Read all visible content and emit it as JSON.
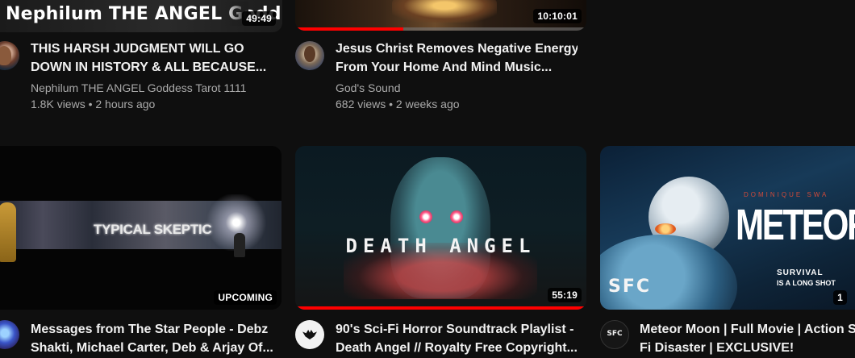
{
  "videos": [
    {
      "thumb_text": "Nephilum THE ANGEL Godd",
      "duration": "49:49",
      "title_line1": "THIS HARSH JUDGMENT WILL GO",
      "title_line2": "DOWN IN HISTORY & ALL BECAUSE...",
      "channel": "Nephilum THE ANGEL Goddess Tarot 1111",
      "stats": "1.8K views • 2 hours ago"
    },
    {
      "duration": "10:10:01",
      "watch_progress": 0.37,
      "title_line1": "Jesus Christ Removes Negative Energy",
      "title_line2": "From Your Home And Mind Music...",
      "channel": "God's Sound",
      "stats": "682 views • 2 weeks ago"
    },
    {
      "thumb_text": "TYPICAL SKEPTIC",
      "badge": "UPCOMING",
      "title_line1": "Messages from The Star People - Debz",
      "title_line2": "Shakti, Michael Carter, Deb & Arjay Of..."
    },
    {
      "thumb_text": "DEATH ANGEL",
      "duration": "55:19",
      "watch_progress": 1.0,
      "title_line1": "90's Sci-Fi Horror Soundtrack Playlist -",
      "title_line2": "Death Angel // Royalty Free Copyright..."
    },
    {
      "thumb_top_text": "DOMINIQUE SWA",
      "thumb_text": "METEOR MO",
      "thumb_logo": "SFC",
      "thumb_tag_1": "SURVIVAL",
      "thumb_tag_2": "IS A LONG SHOT",
      "duration": "1",
      "avatar_text": "SFC",
      "title_line1": "Meteor Moon | Full Movie | Action Sc",
      "title_line2": "Fi Disaster | EXCLUSIVE!"
    }
  ],
  "colors": {
    "background": "#0f0f0f",
    "progress": "#ff0000",
    "secondary_text": "#aaaaaa"
  }
}
